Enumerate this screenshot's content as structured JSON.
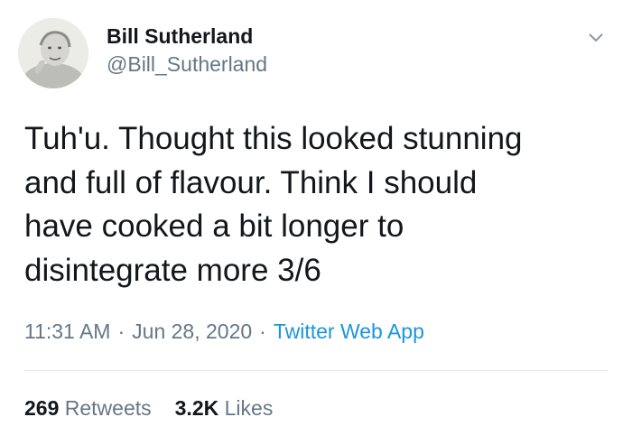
{
  "tweet": {
    "author": {
      "display_name": "Bill Sutherland",
      "handle": "@Bill_Sutherland",
      "avatar_icon": "profile-photo"
    },
    "menu_icon": "chevron-down-icon",
    "text": "Tuh'u. Thought this looked stunning\nand full of flavour. Think I should\nhave cooked a bit longer to\ndisintegrate more 3/6",
    "time": "11:31 AM",
    "separator": "·",
    "date": "Jun 28, 2020",
    "source": "Twitter Web App",
    "stats": {
      "retweets_count": "269",
      "retweets_label": "Retweets",
      "likes_count": "3.2K",
      "likes_label": "Likes"
    }
  },
  "colors": {
    "text_primary": "#14171a",
    "text_secondary": "#657786",
    "link": "#1b95e0",
    "divider": "#e1e8ed"
  }
}
